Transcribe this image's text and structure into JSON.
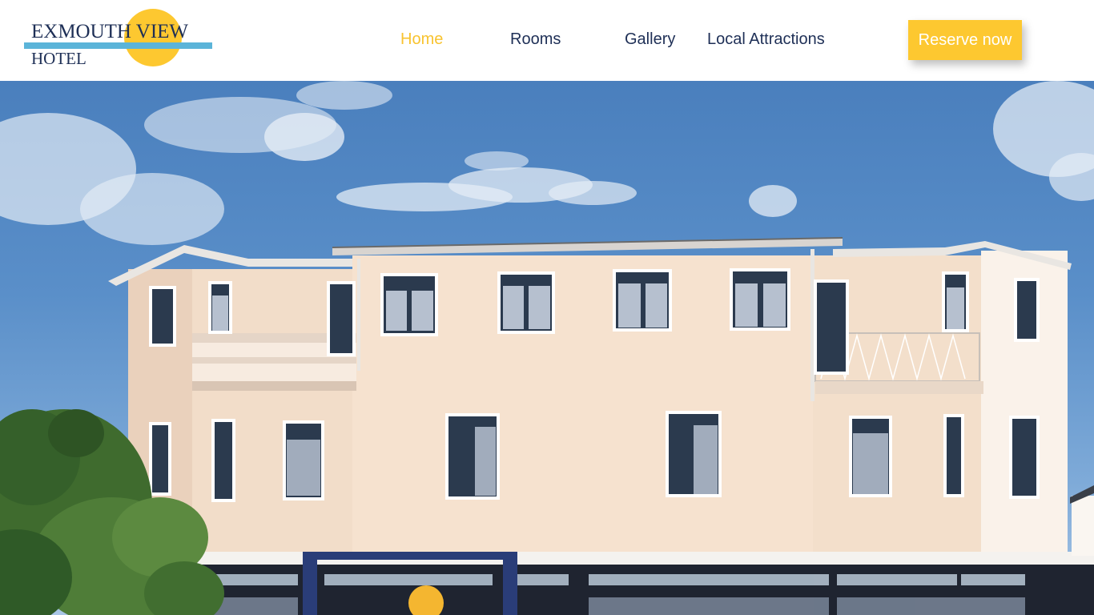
{
  "brand": {
    "name_line1": "EXMOUTH VIEW",
    "name_line2": "HOTEL",
    "colors": {
      "primary": "#1e2f56",
      "sun": "#fdc830",
      "bar": "#5bb4d9"
    }
  },
  "nav": {
    "items": [
      {
        "label": "Home",
        "active": true
      },
      {
        "label": "Rooms",
        "active": false
      },
      {
        "label": "Gallery",
        "active": false
      },
      {
        "label": "Local Attractions",
        "active": false
      }
    ],
    "active_color": "#f8c32f"
  },
  "cta": {
    "label": "Reserve now",
    "color": "#fdc830"
  },
  "hero": {
    "image": "hotel-building-photo"
  }
}
